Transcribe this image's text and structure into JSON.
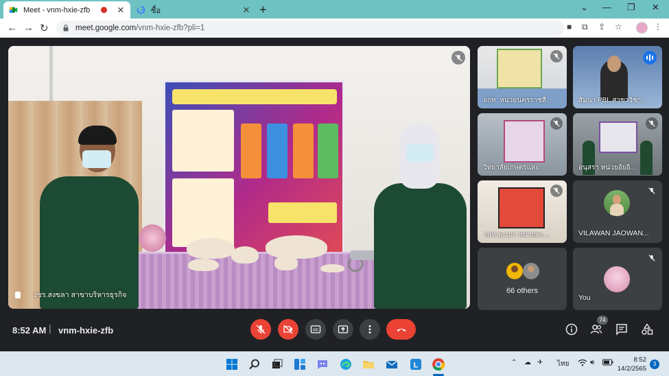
{
  "browser": {
    "tabs": [
      {
        "title": "Meet - vnm-hxie-zfb",
        "active": true,
        "recording": true
      },
      {
        "title": "ซื้อ",
        "active": false
      }
    ],
    "new_tab": "+",
    "url_host": "meet.google.com",
    "url_path": "/vnm-hxie-zfb?pli=1"
  },
  "meet": {
    "main_speaker": {
      "name": "วชร.สงขลา สาขาบริหารธุรกิจ"
    },
    "tiles": [
      {
        "name": "อกท. หน่วยนครราชสี..."
      },
      {
        "name": "สัมนา PBL สาขาวิชา..."
      },
      {
        "name": "วิทยาลัยเกษตรและ..."
      },
      {
        "name": "อนุสรา หน่วยอัยอิ..."
      },
      {
        "name": "วษท.พะเยา หน่วยพะ..."
      },
      {
        "name": "VILAWAN JAOWAN..."
      },
      {
        "name": "66 others"
      },
      {
        "name": "You"
      }
    ],
    "time": "8:52 AM",
    "separator": "|",
    "meeting_code": "vnm-hxie-zfb",
    "participants_count": "74",
    "colors": {
      "accent": "#1a73e8",
      "danger": "#ea4335",
      "surface": "#3c4043",
      "background": "#202124"
    }
  },
  "taskbar": {
    "language": "ไทย",
    "time": "8:52",
    "date": "14/2/2565",
    "notifications": "3"
  }
}
